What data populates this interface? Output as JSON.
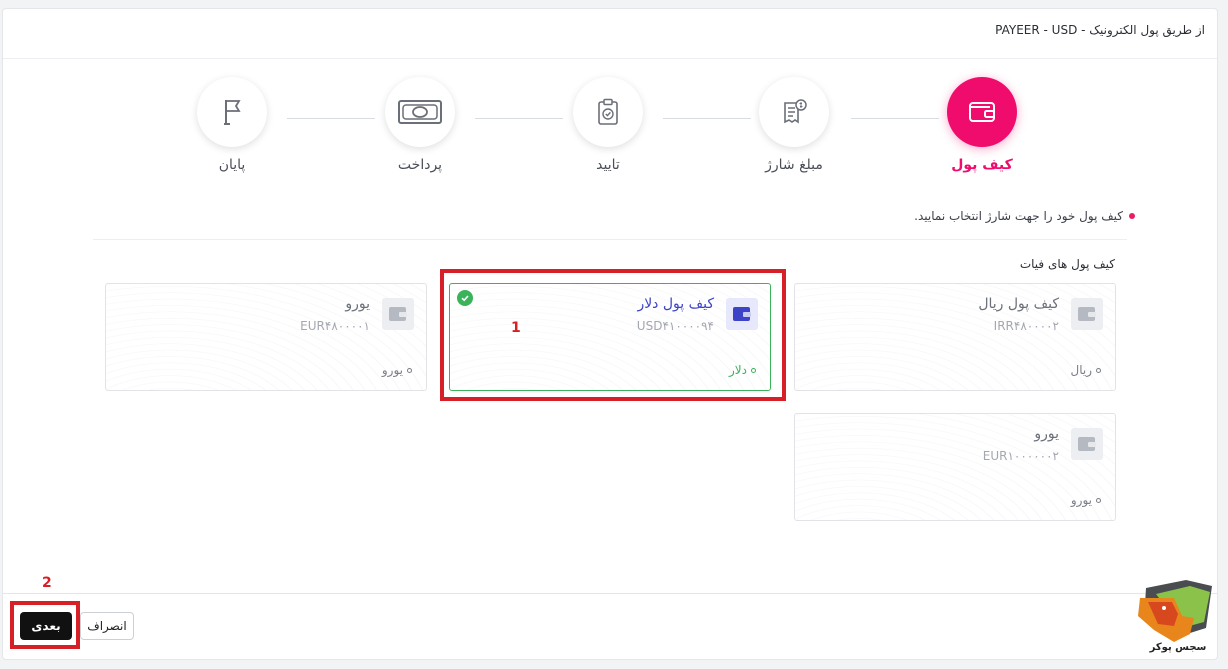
{
  "header": {
    "title": "از طریق پول الکترونیک - PAYEER - USD"
  },
  "steps": [
    {
      "label": "کیف پول",
      "icon": "wallet-icon",
      "active": true
    },
    {
      "label": "مبلغ شارژ",
      "icon": "invoice-icon",
      "active": false
    },
    {
      "label": "تایید",
      "icon": "clipboard-check-icon",
      "active": false
    },
    {
      "label": "پرداخت",
      "icon": "banknote-icon",
      "active": false
    },
    {
      "label": "پایان",
      "icon": "flag-icon",
      "active": false
    }
  ],
  "instruction": "کیف پول خود را جهت شارژ انتخاب نمایید.",
  "section_title": "کیف پول های فیات",
  "cards": [
    {
      "name": "کیف پول ریال",
      "number": "IRR۴۸۰۰۰۰۲",
      "currency": "ریال",
      "selected": false
    },
    {
      "name": "کیف پول دلار",
      "number": "USD۴۱۰۰۰۰۹۴",
      "currency": "دلار",
      "selected": true
    },
    {
      "name": "یورو",
      "number": "EUR۴۸۰۰۰۰۱",
      "currency": "یورو",
      "selected": false
    },
    {
      "name": "یورو",
      "number": "EUR۱۰۰۰۰۰۰۲",
      "currency": "یورو",
      "selected": false
    }
  ],
  "annotations": {
    "one": "1",
    "two": "2"
  },
  "buttons": {
    "next": "بعدی",
    "cancel": "انصراف"
  },
  "logo": {
    "text": "سجس پوکر"
  },
  "colors": {
    "accent": "#ef0c6d",
    "success": "#3bb35b",
    "highlight": "#d61f26",
    "wallet_blue": "#3d43c6"
  }
}
